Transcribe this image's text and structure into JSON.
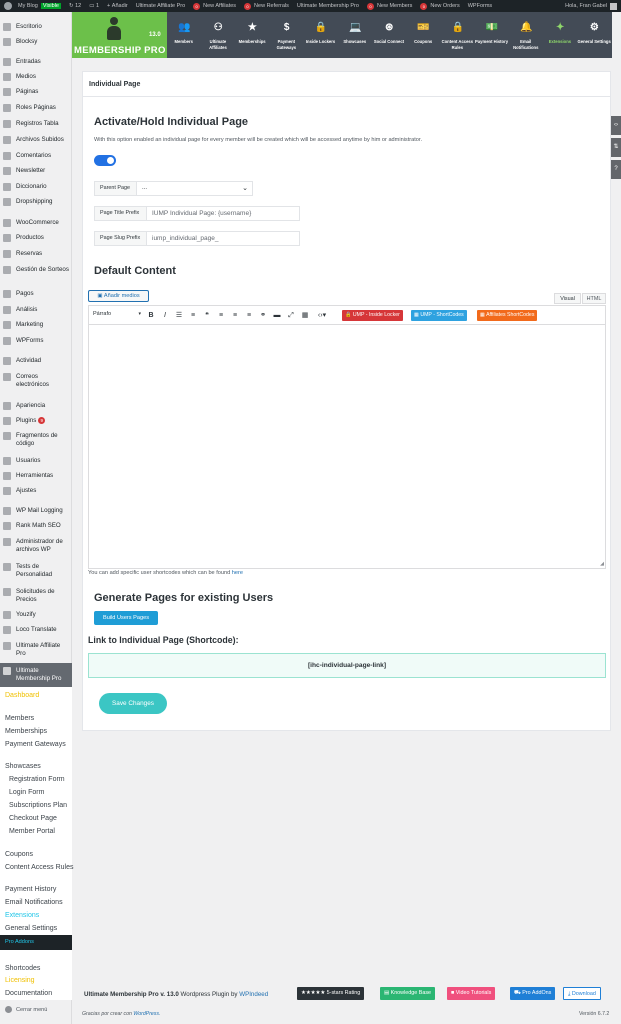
{
  "admin_bar": {
    "site_name": "My Blog",
    "visible_badge": "Visible",
    "updates_count": "12",
    "comments_count": "1",
    "add_new": "Añadir",
    "items": [
      {
        "label": "Ultimate Affiliate Pro",
        "badge": ""
      },
      {
        "label": "New Affiliates",
        "badge": "0"
      },
      {
        "label": "New Referrals",
        "badge": "0"
      },
      {
        "label": "Ultimate Membership Pro",
        "badge": ""
      },
      {
        "label": "New Members",
        "badge": "0"
      },
      {
        "label": "New Orders",
        "badge": "0"
      },
      {
        "label": "WPForms",
        "badge": ""
      }
    ],
    "greeting": "Hola, Fran Gabel"
  },
  "sidebar": {
    "items": [
      {
        "label": "Escritorio"
      },
      {
        "label": "Blocksy"
      },
      {
        "label": "Entradas"
      },
      {
        "label": "Medios"
      },
      {
        "label": "Páginas"
      },
      {
        "label": "Roles Páginas"
      },
      {
        "label": "Registros Tabla"
      },
      {
        "label": "Archivos Subidos"
      },
      {
        "label": "Comentarios"
      },
      {
        "label": "Newsletter"
      },
      {
        "label": "Diccionario"
      },
      {
        "label": "Dropshipping"
      },
      {
        "label": "WooCommerce"
      },
      {
        "label": "Productos"
      },
      {
        "label": "Reservas"
      },
      {
        "label": "Gestión de Sorteos"
      },
      {
        "label": "Pagos"
      },
      {
        "label": "Análisis"
      },
      {
        "label": "Marketing"
      },
      {
        "label": "WPForms"
      },
      {
        "label": "Actividad"
      },
      {
        "label": "Correos electrónicos"
      },
      {
        "label": "Apariencia"
      },
      {
        "label": "Plugins",
        "badge": "9"
      },
      {
        "label": "Fragmentos de código"
      },
      {
        "label": "Usuarios"
      },
      {
        "label": "Herramientas"
      },
      {
        "label": "Ajustes"
      },
      {
        "label": "WP Mail Logging"
      },
      {
        "label": "Rank Math SEO"
      },
      {
        "label": "Administrador de archivos WP"
      },
      {
        "label": "Tests de Personalidad"
      },
      {
        "label": "Solicitudes de Precios"
      },
      {
        "label": "Youzify"
      },
      {
        "label": "Loco Translate"
      },
      {
        "label": "Ultimate Affiliate Pro"
      },
      {
        "label": "Ultimate Membership Pro"
      }
    ],
    "submenu": {
      "dashboard": "Dashboard",
      "members": "Members",
      "memberships": "Memberships",
      "payment_gateways": "Payment Gateways",
      "showcases": "Showcases",
      "registration_form": "Registration Form",
      "login_form": "Login Form",
      "subscriptions_plan": "Subscriptions Plan",
      "checkout_page": "Checkout Page",
      "member_portal": "Member Portal",
      "coupons": "Coupons",
      "content_access_rules": "Content Access Rules",
      "payment_history": "Payment History",
      "email_notifications": "Email Notifications",
      "extensions": "Extensions",
      "general_settings": "General Settings",
      "pro_addons": "Pro Addons",
      "shortcodes": "Shortcodes",
      "licensing": "Licensing",
      "documentation": "Documentation"
    },
    "collapse_label": "Cerrar menú"
  },
  "plugin_header": {
    "version": "13.0",
    "brand": "MEMBERSHIP PRO",
    "tabs": [
      {
        "label": "Members",
        "icon": "users-icon"
      },
      {
        "label": "Ultimate Affiliates",
        "icon": "affiliates-icon"
      },
      {
        "label": "Memberships",
        "icon": "star-icon"
      },
      {
        "label": "Payment Gateways",
        "icon": "dollar-icon"
      },
      {
        "label": "Inside Lockers",
        "icon": "lock-icon"
      },
      {
        "label": "Showcases",
        "icon": "laptop-icon"
      },
      {
        "label": "Social Connect",
        "icon": "dribbble-icon"
      },
      {
        "label": "Coupons",
        "icon": "ticket-icon"
      },
      {
        "label": "Content Access Rules",
        "icon": "lock-icon"
      },
      {
        "label": "Payment History",
        "icon": "money-icon"
      },
      {
        "label": "Email Notifications",
        "icon": "bell-icon"
      },
      {
        "label": "Extensions",
        "icon": "wand-icon"
      },
      {
        "label": "General Settings",
        "icon": "gear-icon"
      }
    ]
  },
  "page": {
    "card_title": "Individual Page",
    "activate_title": "Activate/Hold Individual Page",
    "activate_desc": "With this option enabled an individual page for every member will be created which will be accessed anytime by him or administrator.",
    "parent_page_label": "Parent Page",
    "parent_page_value": "...",
    "title_prefix_label": "Page Title Prefix",
    "title_prefix_value": "IUMP Individual Page: {username}",
    "slug_prefix_label": "Page Slug Prefix",
    "slug_prefix_value": "iump_individual_page_",
    "default_content_title": "Default Content",
    "add_media": "Añadir medios",
    "tab_visual": "Visual",
    "tab_html": "HTML",
    "format_select": "Párrafo",
    "shortcode_buttons": [
      {
        "label": "UMP - Inside Locker",
        "color": "#d63638"
      },
      {
        "label": "UMP - ShortCodes",
        "color": "#2ea2e0"
      },
      {
        "label": "Affiliates ShortCodes",
        "color": "#f26a1b"
      }
    ],
    "note_text": "You can add specific user shortcodes which can be found",
    "note_link": "here",
    "generate_title": "Generate Pages for existing Users",
    "build_button": "Build Users Pages",
    "link_label": "Link to Individual Page (Shortcode):",
    "shortcode": "[ihc-individual-page-link]",
    "save_button": "Save Changes"
  },
  "footer": {
    "product": "Ultimate Membership Pro v. 13.0",
    "tagline": "Wordpress Plugin by",
    "author": "WPIndeed",
    "buttons": [
      {
        "label": "★★★★★ 5-stars Rating",
        "color": "#2c3338"
      },
      {
        "label": "Knowledge Base",
        "color": "#2bb673"
      },
      {
        "label": "Video Tutorials",
        "color": "#f0507e"
      },
      {
        "label": "Pro AddOns",
        "color": "#1f7fd6"
      },
      {
        "label": "Download",
        "color": "#ffffff"
      }
    ],
    "thanks": "Gracias por crear con",
    "thanks_link": "WordPress.",
    "version": "Versión 6.7.2"
  }
}
